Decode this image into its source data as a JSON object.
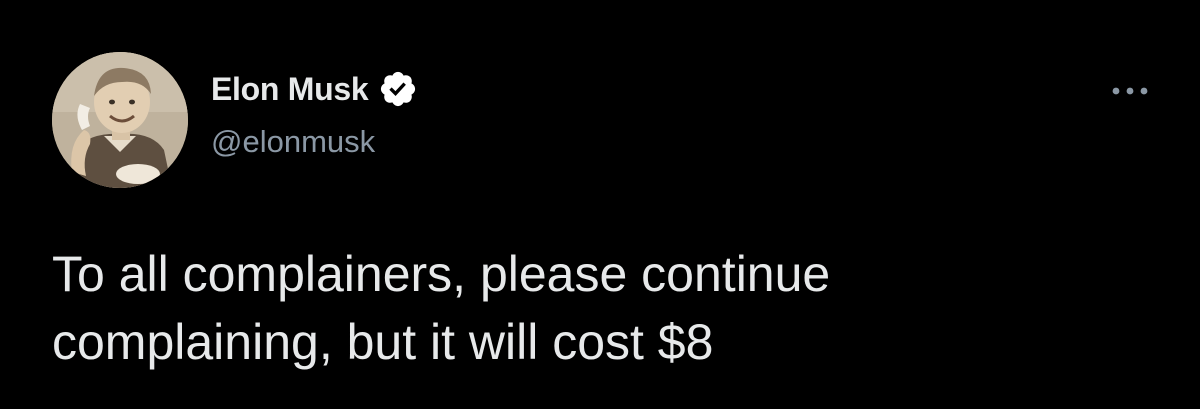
{
  "tweet": {
    "author": {
      "display_name": "Elon Musk",
      "handle": "@elonmusk",
      "verified": true
    },
    "text_lines": [
      "To all complainers, please continue",
      "complaining, but it will cost $8"
    ],
    "icons": {
      "verified": "verified-badge-icon",
      "more": "more-options-icon"
    }
  },
  "colors": {
    "background": "#000000",
    "primary_text": "#e7e9ea",
    "secondary_text": "#8b98a5",
    "verified_badge": "#ffffff"
  }
}
